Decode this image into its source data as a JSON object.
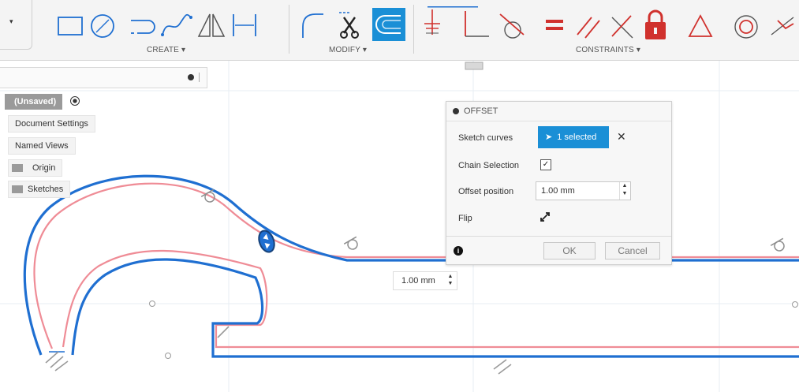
{
  "toolbar": {
    "groups": {
      "create": "CREATE ▾",
      "modify": "MODIFY ▾",
      "constraints": "CONSTRAINTS ▾"
    },
    "dropdown_stub": "▾",
    "icons": [
      "rectangle-icon",
      "circle-icon",
      "slot-icon",
      "spline-icon",
      "mirror-triangle-icon",
      "dimension-line-icon",
      "fillet-icon",
      "trim-scissors-icon",
      "offset-icon",
      "horizontal-vertical-icon",
      "perpendicular-icon",
      "tangent-icon",
      "equal-icon",
      "parallel-icon",
      "coincident-icon",
      "fix-lock-icon",
      "triangle-icon",
      "concentric-icon",
      "midpoint-icon"
    ]
  },
  "browser": {
    "document_name": "(Unsaved)",
    "items": [
      {
        "label": "Document Settings"
      },
      {
        "label": "Named Views"
      },
      {
        "label": "Origin"
      },
      {
        "label": "Sketches"
      }
    ]
  },
  "offset_dialog": {
    "title": "OFFSET",
    "rows": {
      "sketch_curves_label": "Sketch curves",
      "selection_value": "1 selected",
      "chain_selection_label": "Chain Selection",
      "chain_selection_checked": true,
      "offset_position_label": "Offset position",
      "offset_position_value": "1.00 mm",
      "flip_label": "Flip"
    },
    "ok_label": "OK",
    "cancel_label": "Cancel"
  },
  "canvas": {
    "dimension_value": "1.00 mm",
    "colors": {
      "selected_curve": "#1f6fd1",
      "offset_curve": "#ef8c96",
      "grid": "#e7edf3",
      "accent": "#1a8fd6",
      "constraint_red": "#d0312d"
    }
  }
}
